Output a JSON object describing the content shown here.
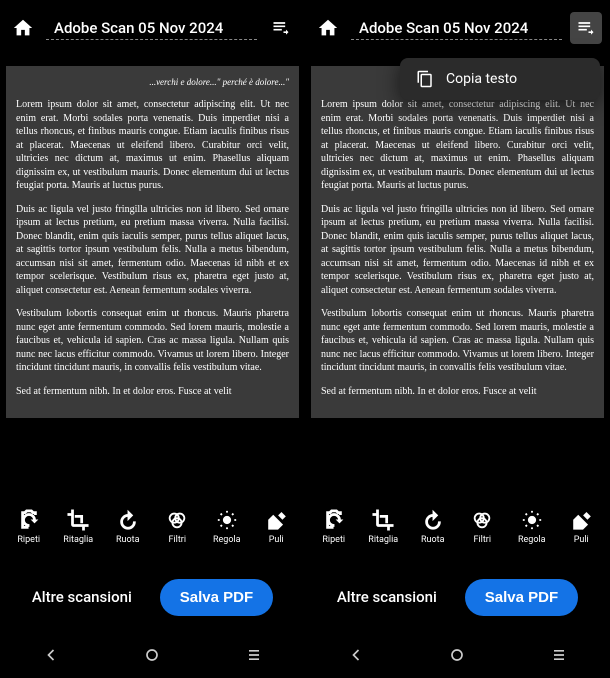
{
  "header": {
    "title": "Adobe Scan 05 Nov 2024"
  },
  "menu": {
    "copy_text": "Copia testo"
  },
  "document": {
    "intro": "...verchi e dolore...\" perché è dolore...\"",
    "p1": "Lorem ipsum dolor sit amet, consectetur adipiscing elit. Ut nec enim erat. Morbi sodales porta venenatis. Duis imperdiet nisi a tellus rhoncus, et finibus mauris congue. Etiam iaculis finibus risus at placerat. Maecenas ut eleifend libero. Curabitur orci velit, ultricies nec dictum at, maximus ut enim. Phasellus aliquam dignissim ex, ut vestibulum mauris. Donec elementum dui ut lectus feugiat porta. Mauris at luctus purus.",
    "p2": "Duis ac ligula vel justo fringilla ultricies non id libero. Sed ornare ipsum at lectus pretium, eu pretium massa viverra. Nulla facilisi. Donec blandit, enim quis iaculis semper, purus tellus aliquet lacus, at sagittis tortor ipsum vestibulum felis. Nulla a metus bibendum, accumsan nisi sit amet, fermentum odio. Maecenas id nibh et ex tempor scelerisque. Vestibulum risus ex, pharetra eget justo at, aliquet consectetur est. Aenean fermentum sodales viverra.",
    "p3": "Vestibulum lobortis consequat enim ut rhoncus. Mauris pharetra nunc eget ante fermentum commodo. Sed lorem mauris, molestie a faucibus et, vehicula id sapien. Cras ac massa ligula. Nullam quis nunc nec lacus efficitur commodo. Vivamus ut lorem libero. Integer tincidunt tincidunt mauris, in convallis felis vestibulum vitae.",
    "p4": "Sed at fermentum nibh. In et dolor eros. Fusce at velit"
  },
  "tools": {
    "retake": "Ripeti",
    "crop": "Ritaglia",
    "rotate": "Ruota",
    "filters": "Filtri",
    "adjust": "Regola",
    "cleanup": "Puli"
  },
  "actions": {
    "more_scans": "Altre scansioni",
    "save_pdf": "Salva PDF"
  }
}
